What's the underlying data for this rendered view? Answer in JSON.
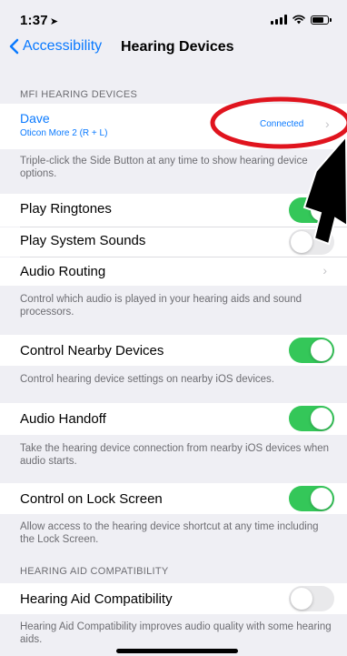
{
  "status_bar": {
    "time": "1:37",
    "location_arrow": "➤"
  },
  "nav": {
    "back_label": "Accessibility",
    "title": "Hearing Devices"
  },
  "mfi": {
    "header": "MFI HEARING DEVICES",
    "device_name": "Dave",
    "device_model": "Oticon More 2 (R + L)",
    "device_status": "Connected",
    "footer": "Triple-click the Side Button at any time to show hearing device options."
  },
  "settings": {
    "play_ringtones": {
      "label": "Play Ringtones",
      "on": true
    },
    "play_system_sounds": {
      "label": "Play System Sounds",
      "on": false
    },
    "audio_routing": {
      "label": "Audio Routing"
    },
    "routing_footer": "Control which audio is played in your hearing aids and sound processors.",
    "control_nearby": {
      "label": "Control Nearby Devices",
      "on": true
    },
    "nearby_footer": "Control hearing device settings on nearby iOS devices.",
    "audio_handoff": {
      "label": "Audio Handoff",
      "on": true
    },
    "handoff_footer": "Take the hearing device connection from nearby iOS devices when audio starts.",
    "lock_screen": {
      "label": "Control on Lock Screen",
      "on": true
    },
    "lock_footer": "Allow access to the hearing device shortcut at any time including the Lock Screen."
  },
  "hac": {
    "header": "HEARING AID COMPATIBILITY",
    "label": "Hearing Aid Compatibility",
    "on": false,
    "footer": "Hearing Aid Compatibility improves audio quality with some hearing aids."
  },
  "colors": {
    "accent": "#0a7aff",
    "toggle_on": "#34c759",
    "annotation_red": "#e0141e"
  }
}
